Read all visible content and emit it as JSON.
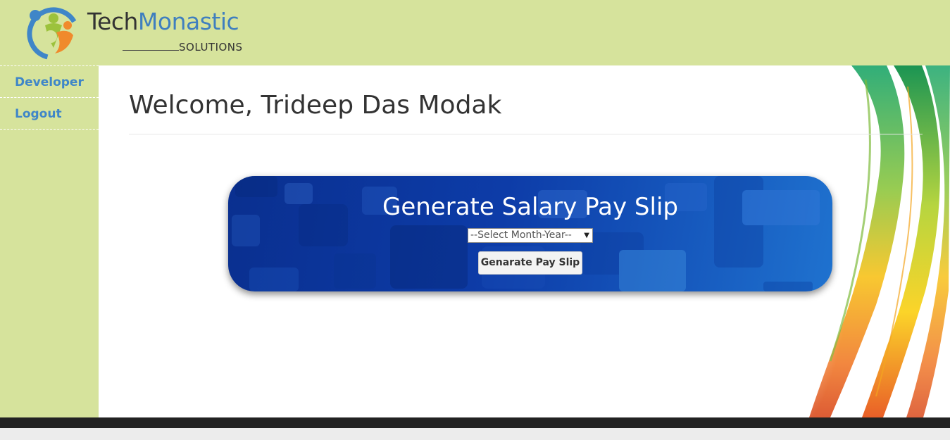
{
  "brand": {
    "name_part1": "Tech",
    "name_part2": "Monastic",
    "subtitle": "SOLUTIONS"
  },
  "sidebar": {
    "items": [
      {
        "label": "Developer"
      },
      {
        "label": "Logout"
      }
    ]
  },
  "main": {
    "welcome": "Welcome, Trideep Das Modak"
  },
  "payslip": {
    "title": "Generate Salary Pay Slip",
    "select_value": "--Select Month-Year--",
    "button_label": "Genarate Pay Slip"
  },
  "colors": {
    "header_bg": "#d6e39c",
    "link": "#3f86c8",
    "card_blue": "#0d3ca8",
    "footer": "#222222"
  }
}
